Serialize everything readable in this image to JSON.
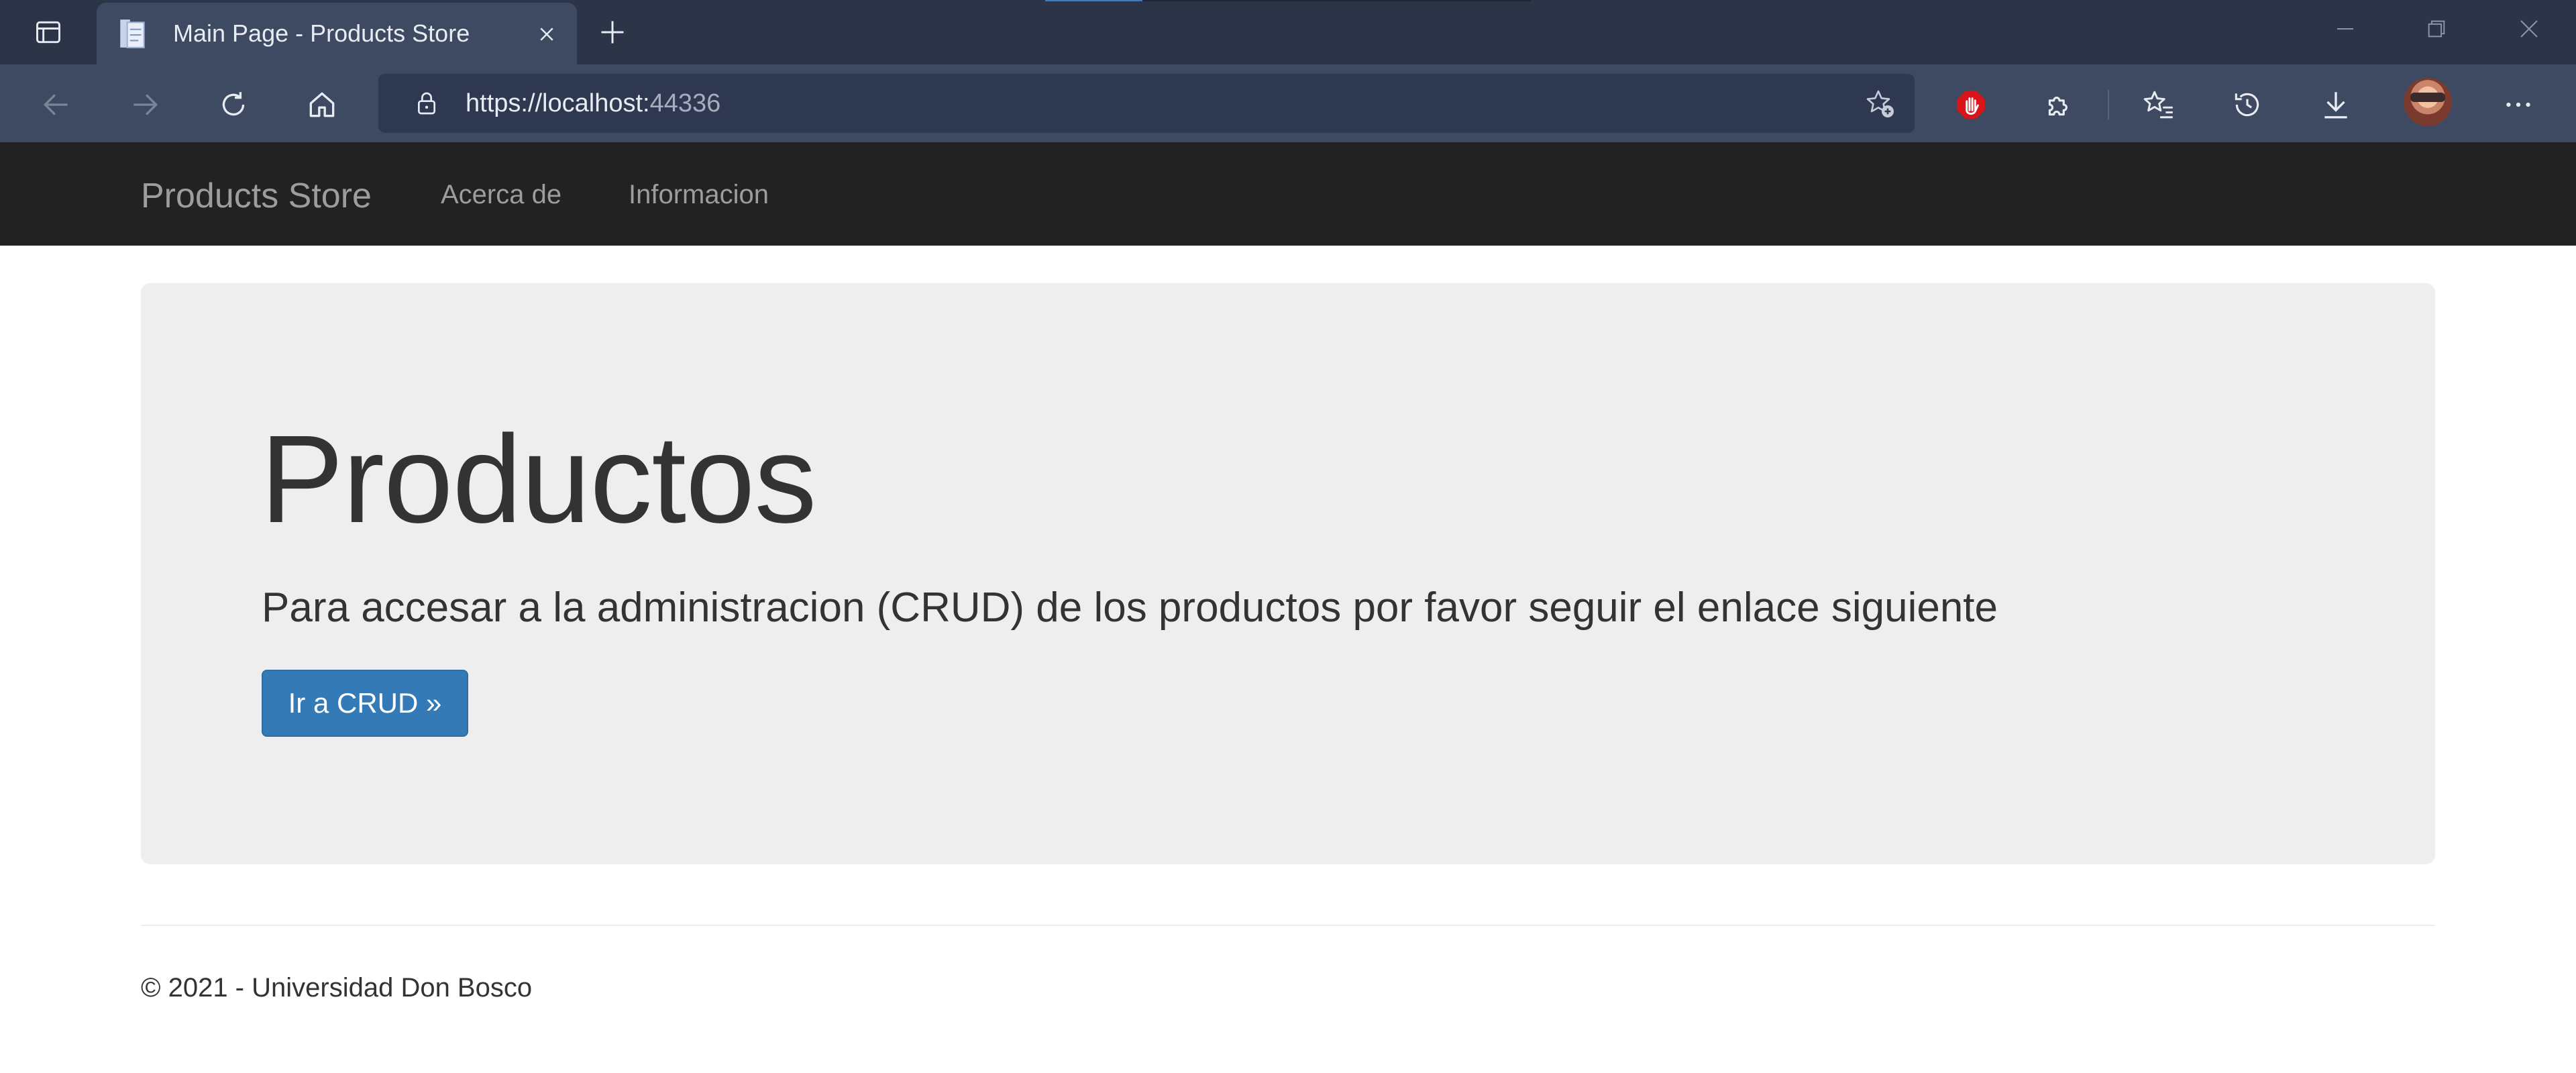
{
  "browser": {
    "tab": {
      "title": "Main Page - Products Store",
      "favicon": "document-icon"
    },
    "address": {
      "scheme_host": "https://localhost:",
      "port": "44336"
    },
    "icons": {
      "tab_actions": "tab-actions-icon",
      "close_tab": "close-icon",
      "new_tab": "plus-icon",
      "back": "arrow-left-icon",
      "forward": "arrow-right-icon",
      "refresh": "refresh-icon",
      "home": "home-icon",
      "lock": "lock-icon",
      "add_favorite": "star-add-icon",
      "adblock": "stop-hand-icon",
      "extensions": "puzzle-icon",
      "favorites": "favorites-icon",
      "history": "history-icon",
      "downloads": "download-icon",
      "menu": "more-icon",
      "minimize": "minimize-icon",
      "restore": "restore-icon",
      "close_window": "close-window-icon"
    },
    "colors": {
      "tabbar": "#2c3548",
      "toolbar": "#3e4a62",
      "address": "#2e3850"
    }
  },
  "navbar": {
    "brand": "Products Store",
    "links": [
      "Acerca de",
      "Informacion"
    ],
    "background": "#222222"
  },
  "jumbotron": {
    "heading": "Productos",
    "lead": "Para accesar a la administracion (CRUD) de los productos por favor seguir el enlace siguiente",
    "button": "Ir a CRUD »",
    "button_color": "#337ab7"
  },
  "footer": {
    "text": "© 2021 - Universidad Don Bosco"
  }
}
